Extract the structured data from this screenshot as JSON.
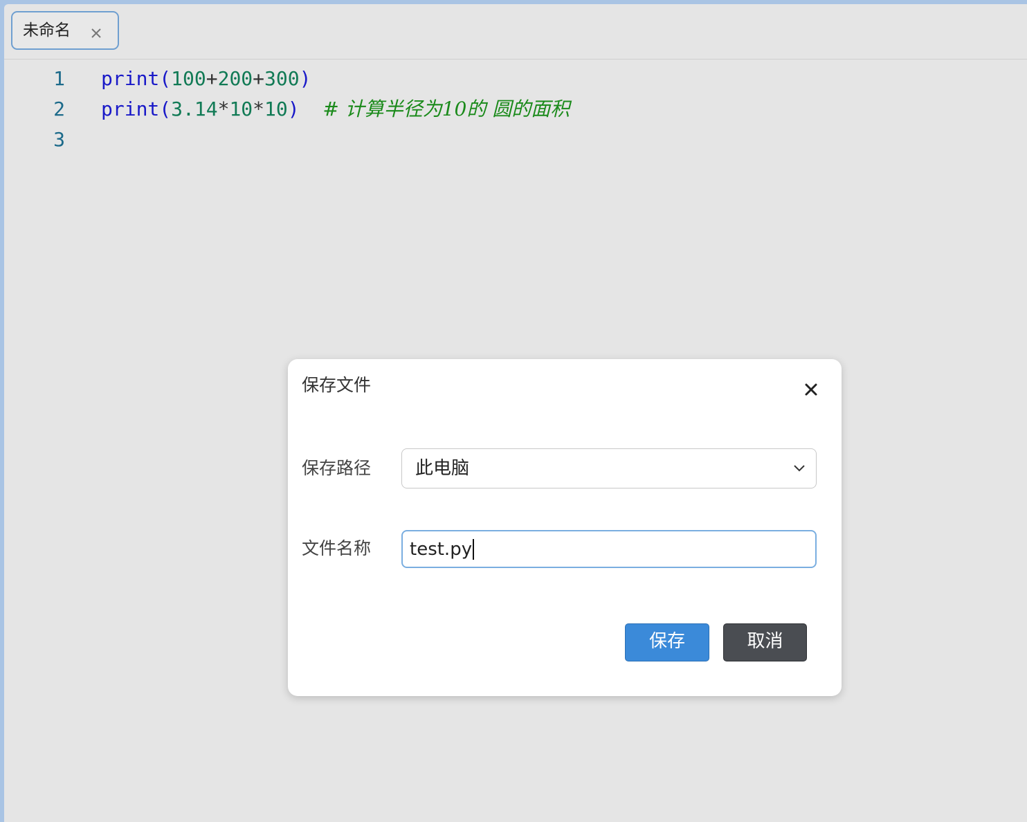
{
  "tab": {
    "title": "未命名"
  },
  "editor": {
    "line_numbers": [
      "1",
      "2",
      "3"
    ],
    "lines": [
      {
        "tokens": [
          {
            "type": "kw",
            "text": "print"
          },
          {
            "type": "kw",
            "text": "("
          },
          {
            "type": "num",
            "text": "100"
          },
          {
            "type": "op",
            "text": "+"
          },
          {
            "type": "num",
            "text": "200"
          },
          {
            "type": "op",
            "text": "+"
          },
          {
            "type": "num",
            "text": "300"
          },
          {
            "type": "kw",
            "text": ")"
          }
        ]
      },
      {
        "tokens": [
          {
            "type": "kw",
            "text": "print"
          },
          {
            "type": "kw",
            "text": "("
          },
          {
            "type": "num",
            "text": "3.14"
          },
          {
            "type": "op",
            "text": "*"
          },
          {
            "type": "num",
            "text": "10"
          },
          {
            "type": "op",
            "text": "*"
          },
          {
            "type": "num",
            "text": "10"
          },
          {
            "type": "kw",
            "text": ")"
          },
          {
            "type": "op",
            "text": "  "
          },
          {
            "type": "cmt",
            "text": "# 计算半径为10的 圆的面积"
          }
        ]
      },
      {
        "tokens": []
      }
    ],
    "colors": {
      "keyword": "#1919c8",
      "number": "#117a55",
      "comment": "#1a8a1a",
      "line_number": "#1c6a8a"
    }
  },
  "dialog": {
    "title": "保存文件",
    "path_label": "保存路径",
    "path_value": "此电脑",
    "filename_label": "文件名称",
    "filename_value": "test.py",
    "save_label": "保存",
    "cancel_label": "取消",
    "colors": {
      "primary": "#3b8ad9",
      "secondary": "#4a4d52"
    }
  }
}
